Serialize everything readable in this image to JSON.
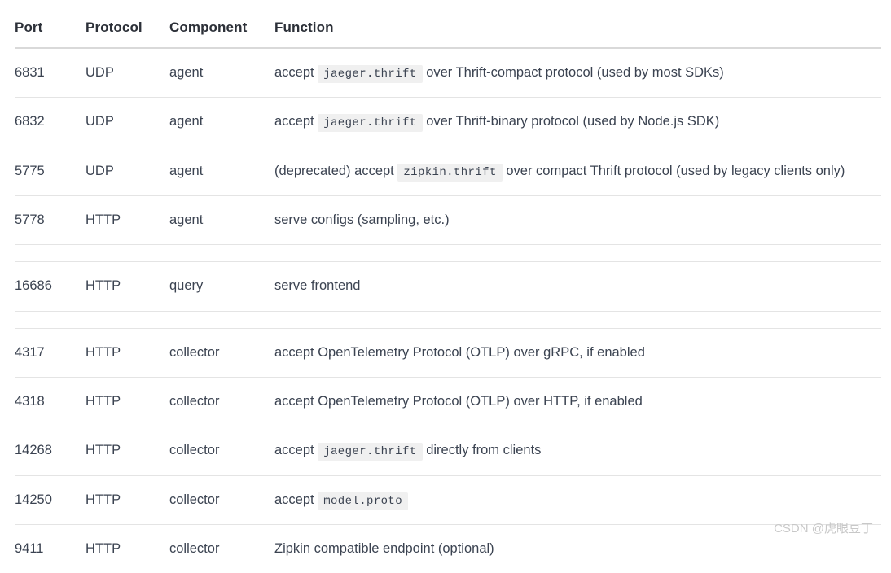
{
  "table": {
    "columns": [
      "Port",
      "Protocol",
      "Component",
      "Function"
    ],
    "rows": [
      {
        "port": "6831",
        "protocol": "UDP",
        "component": "agent",
        "function_parts": [
          {
            "type": "text",
            "value": "accept "
          },
          {
            "type": "code",
            "value": "jaeger.thrift"
          },
          {
            "type": "text",
            "value": " over Thrift-compact protocol (used by most SDKs)"
          }
        ]
      },
      {
        "port": "6832",
        "protocol": "UDP",
        "component": "agent",
        "function_parts": [
          {
            "type": "text",
            "value": "accept "
          },
          {
            "type": "code",
            "value": "jaeger.thrift"
          },
          {
            "type": "text",
            "value": " over Thrift-binary protocol (used by Node.js SDK)"
          }
        ]
      },
      {
        "port": "5775",
        "protocol": "UDP",
        "component": "agent",
        "function_parts": [
          {
            "type": "text",
            "value": "(deprecated) accept "
          },
          {
            "type": "code",
            "value": "zipkin.thrift"
          },
          {
            "type": "text",
            "value": " over compact Thrift protocol (used by legacy clients only)"
          }
        ]
      },
      {
        "port": "5778",
        "protocol": "HTTP",
        "component": "agent",
        "function_parts": [
          {
            "type": "text",
            "value": "serve configs (sampling, etc.)"
          }
        ]
      },
      {
        "spacer": true
      },
      {
        "port": "16686",
        "protocol": "HTTP",
        "component": "query",
        "function_parts": [
          {
            "type": "text",
            "value": "serve frontend"
          }
        ]
      },
      {
        "spacer": true
      },
      {
        "port": "4317",
        "protocol": "HTTP",
        "component": "collector",
        "function_parts": [
          {
            "type": "text",
            "value": "accept OpenTelemetry Protocol (OTLP) over gRPC, if enabled"
          }
        ]
      },
      {
        "port": "4318",
        "protocol": "HTTP",
        "component": "collector",
        "function_parts": [
          {
            "type": "text",
            "value": "accept OpenTelemetry Protocol (OTLP) over HTTP, if enabled"
          }
        ]
      },
      {
        "port": "14268",
        "protocol": "HTTP",
        "component": "collector",
        "function_parts": [
          {
            "type": "text",
            "value": "accept "
          },
          {
            "type": "code",
            "value": "jaeger.thrift"
          },
          {
            "type": "text",
            "value": " directly from clients"
          }
        ]
      },
      {
        "port": "14250",
        "protocol": "HTTP",
        "component": "collector",
        "function_parts": [
          {
            "type": "text",
            "value": "accept "
          },
          {
            "type": "code",
            "value": "model.proto"
          }
        ]
      },
      {
        "port": "9411",
        "protocol": "HTTP",
        "component": "collector",
        "function_parts": [
          {
            "type": "text",
            "value": "Zipkin compatible endpoint (optional)"
          }
        ]
      }
    ]
  },
  "watermark": {
    "text": "CSDN @虎眼豆丁"
  },
  "colors": {
    "text": "#3b4351",
    "header_text": "#2c3038",
    "rule": "#e4e4e4",
    "header_rule": "#d9d9d9",
    "code_background": "#f0f0f0",
    "watermark": "#c8c8c8",
    "page_background": "#ffffff"
  }
}
